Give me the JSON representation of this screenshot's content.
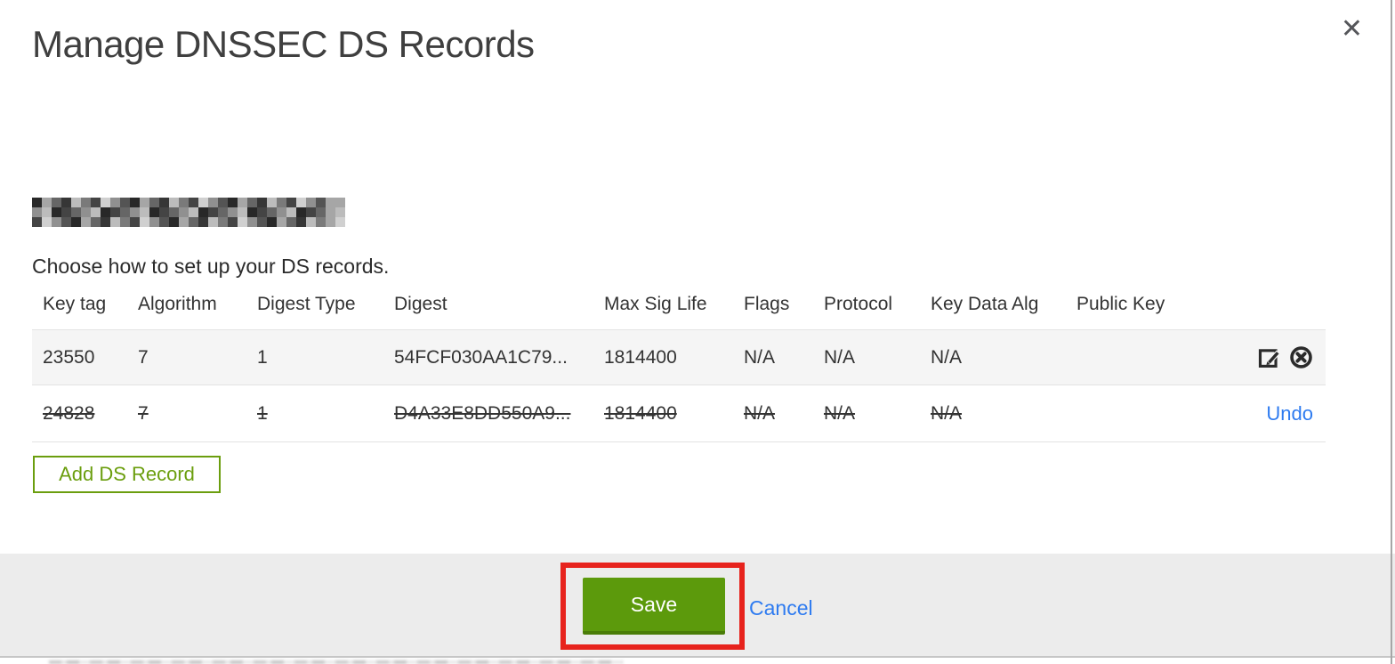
{
  "modal": {
    "title": "Manage DNSSEC DS Records",
    "close_glyph": "✕",
    "instruction": "Choose how to set up your DS records."
  },
  "table": {
    "headers": [
      "Key tag",
      "Algorithm",
      "Digest Type",
      "Digest",
      "Max Sig Life",
      "Flags",
      "Protocol",
      "Key Data Alg",
      "Public Key",
      ""
    ],
    "rows": [
      {
        "key_tag": "23550",
        "algorithm": "7",
        "digest_type": "1",
        "digest": "54FCF030AA1C79...",
        "max_sig_life": "1814400",
        "flags": "N/A",
        "protocol": "N/A",
        "key_data_alg": "N/A",
        "public_key": "",
        "struck_through": false
      },
      {
        "key_tag": "24828",
        "algorithm": "7",
        "digest_type": "1",
        "digest": "D4A33E8DD550A9...",
        "max_sig_life": "1814400",
        "flags": "N/A",
        "protocol": "N/A",
        "key_data_alg": "N/A",
        "public_key": "",
        "undo_label": "Undo",
        "struck_through": true
      }
    ]
  },
  "buttons": {
    "add_ds_record": "Add DS Record",
    "save": "Save",
    "cancel": "Cancel"
  },
  "colors": {
    "save_green": "#5c9a0c",
    "save_green_dark": "#4a7d08",
    "outline_green": "#6b9e0e",
    "link_blue": "#2e7bf0",
    "annotation_red": "#e7231d",
    "row_alt_background": "#f5f5f5",
    "footer_background": "#ececec"
  }
}
